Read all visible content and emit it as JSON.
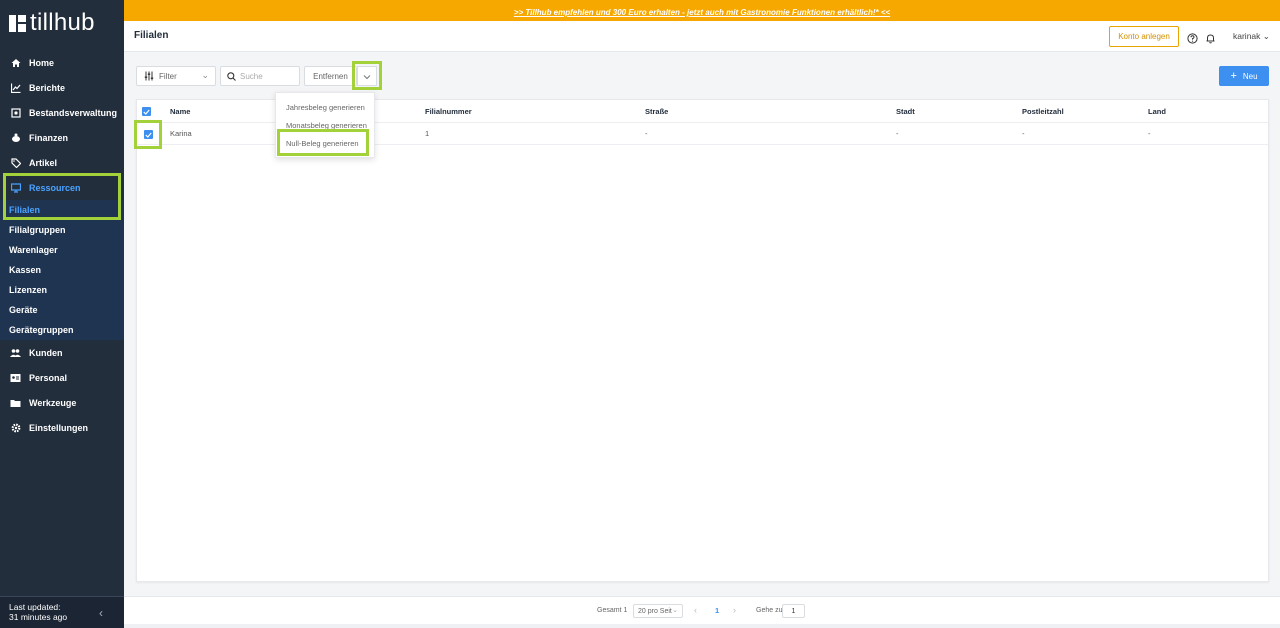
{
  "app": {
    "logo_text": "tillhub"
  },
  "banner": {
    "text": ">> Tillhub empfehlen und 300 Euro erhalten - jetzt auch mit Gastronomie Funktionen erhältlich!* <<"
  },
  "header": {
    "title": "Filialen",
    "konto_label": "Konto anlegen",
    "user": "karinak"
  },
  "sidebar": {
    "items": [
      {
        "label": "Home",
        "icon": "home-icon"
      },
      {
        "label": "Berichte",
        "icon": "chart-icon"
      },
      {
        "label": "Bestandsverwaltung",
        "icon": "inventory-icon"
      },
      {
        "label": "Finanzen",
        "icon": "piggy-bank-icon"
      },
      {
        "label": "Artikel",
        "icon": "tag-icon"
      },
      {
        "label": "Ressourcen",
        "icon": "monitor-icon"
      }
    ],
    "sub_items": [
      {
        "label": "Filialen"
      },
      {
        "label": "Filialgruppen"
      },
      {
        "label": "Warenlager"
      },
      {
        "label": "Kassen"
      },
      {
        "label": "Lizenzen"
      },
      {
        "label": "Geräte"
      },
      {
        "label": "Gerätegruppen"
      }
    ],
    "items_after": [
      {
        "label": "Kunden",
        "icon": "people-icon"
      },
      {
        "label": "Personal",
        "icon": "id-card-icon"
      },
      {
        "label": "Werkzeuge",
        "icon": "folder-icon"
      },
      {
        "label": "Einstellungen",
        "icon": "gear-icon"
      }
    ],
    "footer": {
      "line1": "Last updated:",
      "line2": "31 minutes ago"
    }
  },
  "toolbar": {
    "filter_label": "Filter",
    "search_placeholder": "Suche",
    "remove_label": "Entfernen",
    "new_label": "Neu"
  },
  "menu": {
    "items": [
      "Jahresbeleg generieren",
      "Monatsbeleg generieren",
      "Null-Beleg generieren"
    ]
  },
  "table": {
    "headers": [
      "Name",
      "Filialnummer",
      "Straße",
      "Stadt",
      "Postleitzahl",
      "Land"
    ],
    "rows": [
      {
        "name": "Karina",
        "number": "1",
        "street": "-",
        "city": "-",
        "zip": "-",
        "country": "-"
      }
    ]
  },
  "pagination": {
    "total": "Gesamt 1",
    "page_size": "20 pro Seit",
    "current_page": "1",
    "goto_label": "Gehe zu",
    "goto_value": "1"
  },
  "colors": {
    "sidebar": "#232e3c",
    "banner": "#f6a800",
    "accent": "#3d8ff0",
    "highlight": "#a3d13a"
  }
}
